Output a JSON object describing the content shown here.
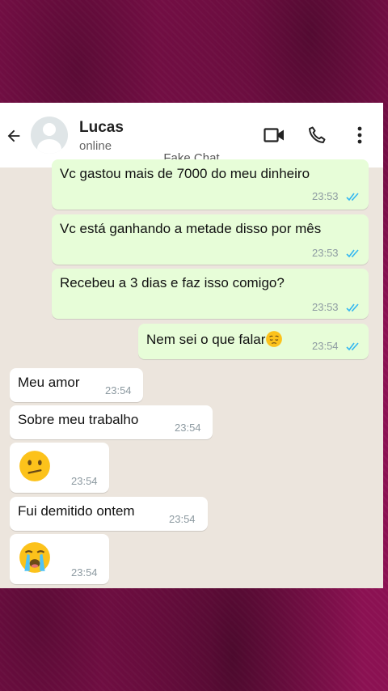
{
  "header": {
    "contact_name": "Lucas",
    "status": "online",
    "watermark": "Fake Chat",
    "icons": [
      "back-arrow-icon",
      "avatar",
      "video-call-icon",
      "phone-icon",
      "more-vert-icon"
    ]
  },
  "messages": [
    {
      "direction": "out",
      "text": "Vc gastou mais de 7000 do meu dinheiro",
      "time": "23:53",
      "status": "read"
    },
    {
      "direction": "out",
      "text": "Vc está ganhando a metade disso por mês",
      "time": "23:53",
      "status": "read"
    },
    {
      "direction": "out",
      "text": "Recebeu a 3 dias e faz isso comigo?",
      "time": "23:53",
      "status": "read"
    },
    {
      "direction": "out",
      "text": "Nem sei o que falar",
      "emoji": "pensive-face",
      "time": "23:54",
      "status": "read"
    },
    {
      "direction": "in",
      "text": "Meu amor",
      "time": "23:54"
    },
    {
      "direction": "in",
      "text": "Sobre meu trabalho",
      "time": "23:54"
    },
    {
      "direction": "in",
      "emoji": "confused-face",
      "time": "23:54"
    },
    {
      "direction": "in",
      "text": "Fui demitido ontem",
      "time": "23:54"
    },
    {
      "direction": "in",
      "emoji": "loudly-crying-face",
      "time": "23:54"
    }
  ],
  "colors": {
    "outgoing_bubble": "#e7fdd8",
    "incoming_bubble": "#ffffff",
    "chat_background": "#ece5dd",
    "read_ticks": "#34b7f1",
    "frame_background": "#8b1152"
  }
}
